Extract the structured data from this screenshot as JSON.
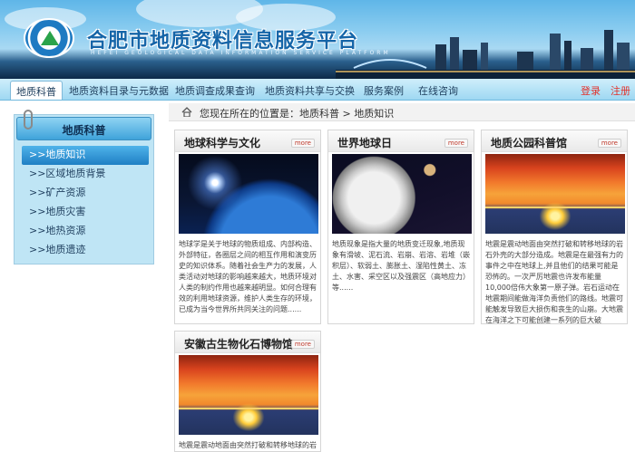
{
  "header": {
    "title": "合肥市地质资料信息服务平台",
    "subtitle": "HEFEI GEOLOGICAL DATA INFORMATION SERVICE PLATFORM"
  },
  "nav": {
    "items": [
      {
        "label": "地质科普",
        "active": true
      },
      {
        "label": "地质资料目录与元数据"
      },
      {
        "label": "地质调查成果查询"
      },
      {
        "label": "地质资料共享与交换"
      },
      {
        "label": "服务案例"
      },
      {
        "label": "在线咨询"
      }
    ],
    "login": "登录",
    "register": "注册"
  },
  "sidebar": {
    "title": "地质科普",
    "items": [
      {
        "label": ">>地质知识",
        "active": true
      },
      {
        "label": ">>区域地质背景"
      },
      {
        "label": ">>矿产资源"
      },
      {
        "label": ">>地质灾害"
      },
      {
        "label": ">>地热资源"
      },
      {
        "label": ">>地质遗迹"
      }
    ]
  },
  "breadcrumb": {
    "text": "您现在所在的位置是：地质科普 > 地质知识"
  },
  "more_label": "more",
  "cards": [
    {
      "title": "地球科学与文化",
      "image": "earth-from-space",
      "desc": "地球学是关于地球的物质组成、内部构造、外部特征，各圈层之间的相互作用和演变历史的知识体系。随着社会生产力的发展，人类活动对地球的影响越来越大，地质环境对人类的制约作用也越来越明显。如何合理有效的利用地球资源，维护人类生存的环境，已成为当今世界所共同关注的问题......"
    },
    {
      "title": "世界地球日",
      "image": "moon-and-planet",
      "desc": "地质现象是指大量的地质变迁现象,地质现象有滑坡、泥石流、岩崩、岩溶、岩堆（嵌积层）、软弱土、膨胀土、湿陷性黄土、冻土、水害、采空区以及强震区（高地应力）等......"
    },
    {
      "title": "地质公园科普馆",
      "image": "sunset-sea",
      "desc": "地震是震动地面由突然打破和转移地球的岩石外壳的大部分造成。地震是在最强有力的事件之中在地球上,并且他们的结果可能是恐怖的。一次严厉地震也许发布能量10,000倍伟大象第一原子弹。岩石运动在地震期间能做海洋负责他们的路线。地震可能触发导致巨大损伤和丧生的山崩。大地震在海洋之下可能创建一系列的巨大破"
    },
    {
      "title": "安徽古生物化石博物馆",
      "image": "sunset-sea",
      "desc": "地震是震动地面由突然打破和转移地球的岩石外壳的大部分造成。地震是在最强有"
    }
  ]
}
